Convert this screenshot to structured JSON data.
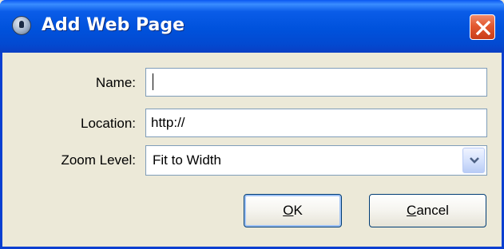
{
  "window": {
    "title": "Add Web Page"
  },
  "form": {
    "name_label": "Name:",
    "name_value": "",
    "location_label": "Location:",
    "location_value": "http://",
    "zoom_label": "Zoom Level:",
    "zoom_value": "Fit to Width"
  },
  "buttons": {
    "ok_mnemonic": "O",
    "ok_rest": "K",
    "cancel_mnemonic": "C",
    "cancel_rest": "ancel"
  },
  "icons": {
    "title": "app-icon",
    "close": "close-icon",
    "dropdown": "chevron-down-icon"
  },
  "colors": {
    "titlebar": "#0052dc",
    "close_button": "#e2582f",
    "dialog_background": "#ece9d8",
    "field_border": "#7f9db9"
  }
}
